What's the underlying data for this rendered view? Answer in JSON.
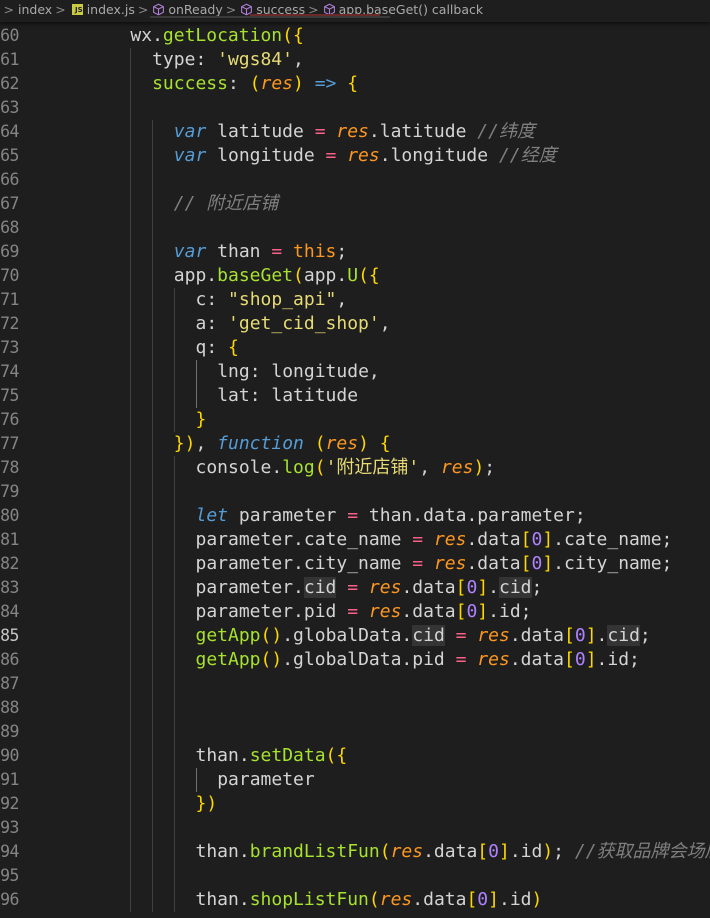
{
  "breadcrumb": {
    "items": [
      {
        "label": "index",
        "icon": "folder",
        "kind": "folder"
      },
      {
        "label": "index.js",
        "icon": "js-file-icon",
        "kind": "file"
      },
      {
        "label": "onReady",
        "icon": "cube-icon",
        "kind": "symbol"
      },
      {
        "label": "success",
        "icon": "cube-icon",
        "kind": "symbol"
      },
      {
        "label": "app.baseGet() callback",
        "icon": "cube-icon",
        "kind": "symbol"
      }
    ],
    "separator": ">"
  },
  "colors": {
    "background": "#1e1e1e",
    "line_number": "#858585",
    "keyword": "#569cd6",
    "string": "#e6db74",
    "function": "#a6e22e",
    "parameter": "#fd971f",
    "operator": "#ff6188",
    "comment": "#7f7f7f",
    "number": "#ae81ff",
    "bracket": "#ffd700"
  },
  "editor": {
    "active_line": "85",
    "lines": [
      {
        "num": "60",
        "indent": 4,
        "tokens": [
          [
            "pu",
            "wx."
          ],
          [
            "fn",
            "getLocation"
          ],
          [
            "br",
            "({"
          ]
        ]
      },
      {
        "num": "61",
        "indent": 6,
        "tokens": [
          [
            "pu",
            "type: "
          ],
          [
            "s",
            "'wgs84'"
          ],
          [
            "pu",
            ","
          ]
        ]
      },
      {
        "num": "62",
        "indent": 6,
        "tokens": [
          [
            "fn",
            "success"
          ],
          [
            "pu",
            ": "
          ],
          [
            "br",
            "("
          ],
          [
            "p",
            "res"
          ],
          [
            "br",
            ")"
          ],
          [
            "pu",
            " "
          ],
          [
            "kw",
            "=>"
          ],
          [
            "pu",
            " "
          ],
          [
            "br",
            "{"
          ]
        ]
      },
      {
        "num": "63",
        "indent": 0,
        "tokens": []
      },
      {
        "num": "64",
        "indent": 8,
        "tokens": [
          [
            "kw",
            "var"
          ],
          [
            "pu",
            " latitude "
          ],
          [
            "op",
            "="
          ],
          [
            "pu",
            " "
          ],
          [
            "p",
            "res"
          ],
          [
            "pu",
            ".latitude "
          ],
          [
            "c",
            "//纬度"
          ]
        ]
      },
      {
        "num": "65",
        "indent": 8,
        "tokens": [
          [
            "kw",
            "var"
          ],
          [
            "pu",
            " longitude "
          ],
          [
            "op",
            "="
          ],
          [
            "pu",
            " "
          ],
          [
            "p",
            "res"
          ],
          [
            "pu",
            ".longitude "
          ],
          [
            "c",
            "//经度"
          ]
        ]
      },
      {
        "num": "66",
        "indent": 0,
        "tokens": []
      },
      {
        "num": "67",
        "indent": 8,
        "tokens": [
          [
            "c",
            "// 附近店铺"
          ]
        ]
      },
      {
        "num": "68",
        "indent": 0,
        "tokens": []
      },
      {
        "num": "69",
        "indent": 8,
        "tokens": [
          [
            "kw",
            "var"
          ],
          [
            "pu",
            " than "
          ],
          [
            "op",
            "="
          ],
          [
            "pu",
            " "
          ],
          [
            "th",
            "this"
          ],
          [
            "pu",
            ";"
          ]
        ]
      },
      {
        "num": "70",
        "indent": 8,
        "tokens": [
          [
            "pu",
            "app."
          ],
          [
            "fn",
            "baseGet"
          ],
          [
            "br",
            "("
          ],
          [
            "pu",
            "app."
          ],
          [
            "fn",
            "U"
          ],
          [
            "br",
            "({"
          ]
        ]
      },
      {
        "num": "71",
        "indent": 10,
        "tokens": [
          [
            "pu",
            "c: "
          ],
          [
            "s",
            "\"shop_api\""
          ],
          [
            "pu",
            ","
          ]
        ]
      },
      {
        "num": "72",
        "indent": 10,
        "tokens": [
          [
            "pu",
            "a: "
          ],
          [
            "s",
            "'get_cid_shop'"
          ],
          [
            "pu",
            ","
          ]
        ]
      },
      {
        "num": "73",
        "indent": 10,
        "tokens": [
          [
            "pu",
            "q: "
          ],
          [
            "br",
            "{"
          ]
        ]
      },
      {
        "num": "74",
        "indent": 12,
        "tokens": [
          [
            "pu",
            "lng: longitude,"
          ]
        ]
      },
      {
        "num": "75",
        "indent": 12,
        "tokens": [
          [
            "pu",
            "lat: latitude"
          ]
        ]
      },
      {
        "num": "76",
        "indent": 10,
        "tokens": [
          [
            "br",
            "}"
          ]
        ]
      },
      {
        "num": "77",
        "indent": 8,
        "tokens": [
          [
            "br",
            "})"
          ],
          [
            "pu",
            ", "
          ],
          [
            "kw",
            "function"
          ],
          [
            "pu",
            " "
          ],
          [
            "br",
            "("
          ],
          [
            "p",
            "res"
          ],
          [
            "br",
            ")"
          ],
          [
            "pu",
            " "
          ],
          [
            "br",
            "{"
          ]
        ]
      },
      {
        "num": "78",
        "indent": 10,
        "tokens": [
          [
            "pu",
            "console."
          ],
          [
            "fn",
            "log"
          ],
          [
            "br",
            "("
          ],
          [
            "s",
            "'附近店铺'"
          ],
          [
            "pu",
            ", "
          ],
          [
            "p",
            "res"
          ],
          [
            "br",
            ")"
          ],
          [
            "pu",
            ";"
          ]
        ]
      },
      {
        "num": "79",
        "indent": 0,
        "tokens": []
      },
      {
        "num": "80",
        "indent": 10,
        "tokens": [
          [
            "kw",
            "let"
          ],
          [
            "pu",
            " parameter "
          ],
          [
            "op",
            "="
          ],
          [
            "pu",
            " than.data.parameter;"
          ]
        ]
      },
      {
        "num": "81",
        "indent": 10,
        "tokens": [
          [
            "pu",
            "parameter.cate_name "
          ],
          [
            "op",
            "="
          ],
          [
            "pu",
            " "
          ],
          [
            "p",
            "res"
          ],
          [
            "pu",
            ".data"
          ],
          [
            "br",
            "["
          ],
          [
            "n",
            "0"
          ],
          [
            "br",
            "]"
          ],
          [
            "pu",
            ".cate_name;"
          ]
        ]
      },
      {
        "num": "82",
        "indent": 10,
        "tokens": [
          [
            "pu",
            "parameter.city_name "
          ],
          [
            "op",
            "="
          ],
          [
            "pu",
            " "
          ],
          [
            "p",
            "res"
          ],
          [
            "pu",
            ".data"
          ],
          [
            "br",
            "["
          ],
          [
            "n",
            "0"
          ],
          [
            "br",
            "]"
          ],
          [
            "pu",
            ".city_name;"
          ]
        ]
      },
      {
        "num": "83",
        "indent": 10,
        "tokens": [
          [
            "pu",
            "parameter."
          ],
          [
            "hl",
            "cid"
          ],
          [
            "pu",
            " "
          ],
          [
            "op",
            "="
          ],
          [
            "pu",
            " "
          ],
          [
            "p",
            "res"
          ],
          [
            "pu",
            ".data"
          ],
          [
            "br",
            "["
          ],
          [
            "n",
            "0"
          ],
          [
            "br",
            "]"
          ],
          [
            "pu",
            "."
          ],
          [
            "hl",
            "cid"
          ],
          [
            "pu",
            ";"
          ]
        ]
      },
      {
        "num": "84",
        "indent": 10,
        "tokens": [
          [
            "pu",
            "parameter.pid "
          ],
          [
            "op",
            "="
          ],
          [
            "pu",
            " "
          ],
          [
            "p",
            "res"
          ],
          [
            "pu",
            ".data"
          ],
          [
            "br",
            "["
          ],
          [
            "n",
            "0"
          ],
          [
            "br",
            "]"
          ],
          [
            "pu",
            ".id;"
          ]
        ]
      },
      {
        "num": "85",
        "indent": 10,
        "tokens": [
          [
            "fn",
            "getApp"
          ],
          [
            "br",
            "()"
          ],
          [
            "pu",
            ".globalData."
          ],
          [
            "hl",
            "cid"
          ],
          [
            "pu",
            " "
          ],
          [
            "op",
            "="
          ],
          [
            "pu",
            " "
          ],
          [
            "p",
            "res"
          ],
          [
            "pu",
            ".data"
          ],
          [
            "br",
            "["
          ],
          [
            "n",
            "0"
          ],
          [
            "br",
            "]"
          ],
          [
            "pu",
            "."
          ],
          [
            "hl",
            "cid"
          ],
          [
            "pu",
            ";"
          ]
        ]
      },
      {
        "num": "86",
        "indent": 10,
        "tokens": [
          [
            "fn",
            "getApp"
          ],
          [
            "br",
            "()"
          ],
          [
            "pu",
            ".globalData.pid "
          ],
          [
            "op",
            "="
          ],
          [
            "pu",
            " "
          ],
          [
            "p",
            "res"
          ],
          [
            "pu",
            ".data"
          ],
          [
            "br",
            "["
          ],
          [
            "n",
            "0"
          ],
          [
            "br",
            "]"
          ],
          [
            "pu",
            ".id;"
          ]
        ]
      },
      {
        "num": "87",
        "indent": 0,
        "tokens": []
      },
      {
        "num": "88",
        "indent": 0,
        "tokens": []
      },
      {
        "num": "89",
        "indent": 0,
        "tokens": []
      },
      {
        "num": "90",
        "indent": 10,
        "tokens": [
          [
            "pu",
            "than."
          ],
          [
            "fn",
            "setData"
          ],
          [
            "br",
            "({"
          ]
        ]
      },
      {
        "num": "91",
        "indent": 12,
        "tokens": [
          [
            "pu",
            "parameter"
          ]
        ]
      },
      {
        "num": "92",
        "indent": 10,
        "tokens": [
          [
            "br",
            "})"
          ]
        ]
      },
      {
        "num": "93",
        "indent": 0,
        "tokens": []
      },
      {
        "num": "94",
        "indent": 10,
        "tokens": [
          [
            "pu",
            "than."
          ],
          [
            "fn",
            "brandListFun"
          ],
          [
            "br",
            "("
          ],
          [
            "p",
            "res"
          ],
          [
            "pu",
            ".data"
          ],
          [
            "br",
            "["
          ],
          [
            "n",
            "0"
          ],
          [
            "br",
            "]"
          ],
          [
            "pu",
            ".id"
          ],
          [
            "br",
            ")"
          ],
          [
            "pu",
            "; "
          ],
          [
            "c",
            "//获取品牌会场店铺列"
          ]
        ]
      },
      {
        "num": "95",
        "indent": 0,
        "tokens": []
      },
      {
        "num": "96",
        "indent": 10,
        "tokens": [
          [
            "pu",
            "than."
          ],
          [
            "fn",
            "shopListFun"
          ],
          [
            "br",
            "("
          ],
          [
            "p",
            "res"
          ],
          [
            "pu",
            ".data"
          ],
          [
            "br",
            "["
          ],
          [
            "n",
            "0"
          ],
          [
            "br",
            "]"
          ],
          [
            "pu",
            ".id"
          ],
          [
            "br",
            ")"
          ]
        ]
      }
    ]
  }
}
